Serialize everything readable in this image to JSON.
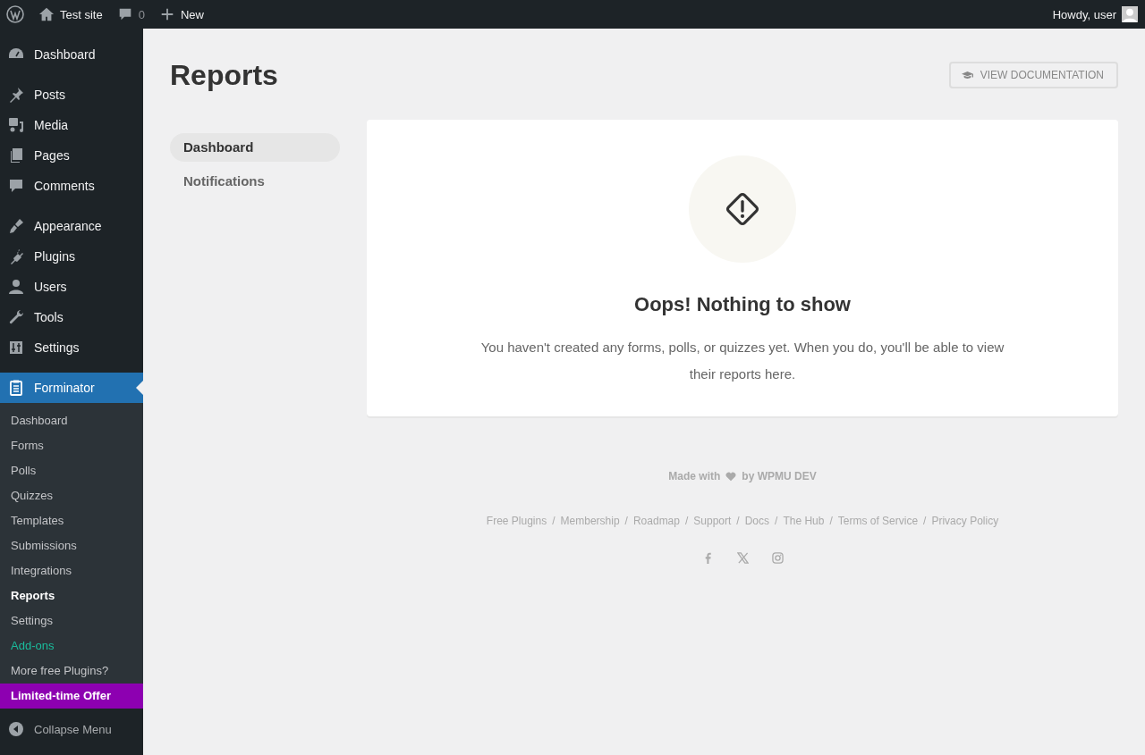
{
  "admin_bar": {
    "site": "Test site",
    "comments": "0",
    "new": "New",
    "greeting": "Howdy, user"
  },
  "sidebar": {
    "groups": [
      {
        "items": [
          {
            "label": "Dashboard",
            "kind": "gauge",
            "selected": false
          }
        ]
      },
      {
        "items": [
          {
            "label": "Posts",
            "kind": "pin",
            "selected": false
          },
          {
            "label": "Media",
            "kind": "media",
            "selected": false
          },
          {
            "label": "Pages",
            "kind": "pages",
            "selected": false
          },
          {
            "label": "Comments",
            "kind": "bubble",
            "selected": false
          }
        ]
      },
      {
        "items": [
          {
            "label": "Appearance",
            "kind": "brush",
            "selected": false
          },
          {
            "label": "Plugins",
            "kind": "plug",
            "selected": false
          },
          {
            "label": "Users",
            "kind": "user",
            "selected": false
          },
          {
            "label": "Tools",
            "kind": "wrench",
            "selected": false
          },
          {
            "label": "Settings",
            "kind": "sliders",
            "selected": false
          }
        ]
      },
      {
        "items": [
          {
            "label": "Forminator",
            "kind": "clipboard",
            "selected": true
          }
        ]
      }
    ],
    "submenu": [
      {
        "label": "Dashboard",
        "kind": "normal",
        "selected": false
      },
      {
        "label": "Forms",
        "kind": "normal",
        "selected": false
      },
      {
        "label": "Polls",
        "kind": "normal",
        "selected": false
      },
      {
        "label": "Quizzes",
        "kind": "normal",
        "selected": false
      },
      {
        "label": "Templates",
        "kind": "normal",
        "selected": false
      },
      {
        "label": "Submissions",
        "kind": "normal",
        "selected": false
      },
      {
        "label": "Integrations",
        "kind": "normal",
        "selected": false
      },
      {
        "label": "Reports",
        "kind": "normal",
        "selected": true
      },
      {
        "label": "Settings",
        "kind": "normal",
        "selected": false
      },
      {
        "label": "Add-ons",
        "kind": "addon",
        "selected": false
      },
      {
        "label": "More free Plugins?",
        "kind": "normal",
        "selected": false
      },
      {
        "label": "Limited-time Offer",
        "kind": "offer",
        "selected": false
      }
    ],
    "collapse": "Collapse Menu"
  },
  "page": {
    "title": "Reports",
    "doc_button": "VIEW DOCUMENTATION"
  },
  "tabs": [
    {
      "label": "Dashboard",
      "selected": true
    },
    {
      "label": "Notifications",
      "selected": false
    }
  ],
  "empty": {
    "title": "Oops! Nothing to show",
    "message": "You haven't created any forms, polls, or quizzes yet. When you do, you'll be able to view their reports here."
  },
  "footer": {
    "made_with": "Made with",
    "by": "by WPMU DEV",
    "separator": "/",
    "links": [
      "Free Plugins",
      "Membership",
      "Roadmap",
      "Support",
      "Docs",
      "The Hub",
      "Terms of Service",
      "Privacy Policy"
    ]
  }
}
